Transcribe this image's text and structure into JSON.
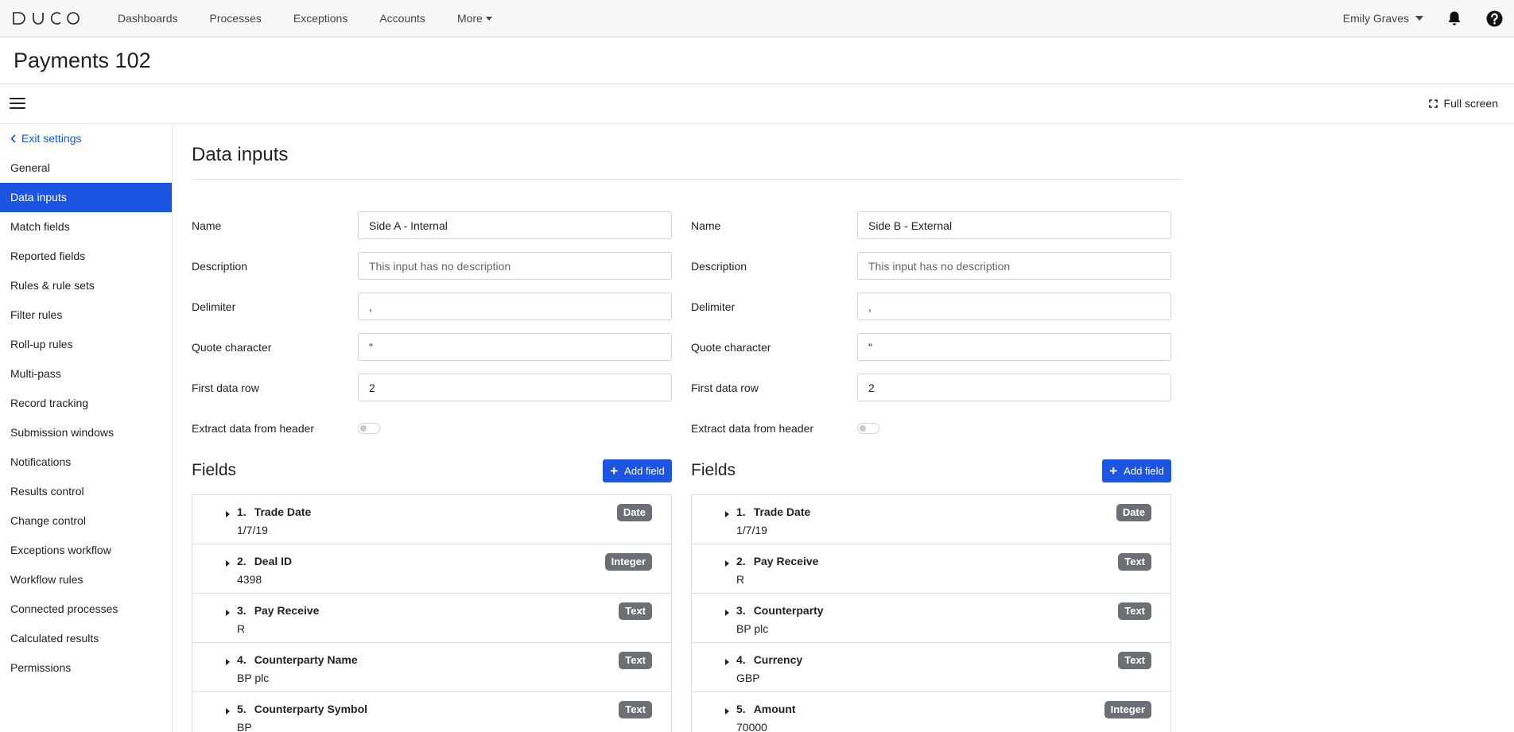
{
  "nav": {
    "logo_text": "DUCO",
    "links": [
      "Dashboards",
      "Processes",
      "Exceptions",
      "Accounts"
    ],
    "more": "More",
    "user": "Emily Graves"
  },
  "page": {
    "title": "Payments 102"
  },
  "toolbar": {
    "fullscreen": "Full screen"
  },
  "sidebar": {
    "exit": "Exit settings",
    "items": [
      "General",
      "Data inputs",
      "Match fields",
      "Reported fields",
      "Rules & rule sets",
      "Filter rules",
      "Roll-up rules",
      "Multi-pass",
      "Record tracking",
      "Submission windows",
      "Notifications",
      "Results control",
      "Change control",
      "Exceptions workflow",
      "Workflow rules",
      "Connected processes",
      "Calculated results",
      "Permissions"
    ],
    "active": "Data inputs"
  },
  "main": {
    "title": "Data inputs",
    "labels": {
      "name": "Name",
      "description": "Description",
      "delimiter": "Delimiter",
      "quote": "Quote character",
      "first_row": "First data row",
      "extract": "Extract data from header",
      "fields": "Fields",
      "add_field": "Add field"
    },
    "side_a": {
      "name": "Side A - Internal",
      "description_placeholder": "This input has no description",
      "delimiter": ",",
      "quote": "\"",
      "first_row": "2",
      "fields": [
        {
          "num": "1.",
          "name": "Trade Date",
          "value": "1/7/19",
          "type": "Date"
        },
        {
          "num": "2.",
          "name": "Deal ID",
          "value": "4398",
          "type": "Integer"
        },
        {
          "num": "3.",
          "name": "Pay Receive",
          "value": "R",
          "type": "Text"
        },
        {
          "num": "4.",
          "name": "Counterparty Name",
          "value": "BP plc",
          "type": "Text"
        },
        {
          "num": "5.",
          "name": "Counterparty Symbol",
          "value": "BP",
          "type": "Text"
        }
      ]
    },
    "side_b": {
      "name": "Side B - External",
      "description_placeholder": "This input has no description",
      "delimiter": ",",
      "quote": "\"",
      "first_row": "2",
      "fields": [
        {
          "num": "1.",
          "name": "Trade Date",
          "value": "1/7/19",
          "type": "Date"
        },
        {
          "num": "2.",
          "name": "Pay Receive",
          "value": "R",
          "type": "Text"
        },
        {
          "num": "3.",
          "name": "Counterparty",
          "value": "BP plc",
          "type": "Text"
        },
        {
          "num": "4.",
          "name": "Currency",
          "value": "GBP",
          "type": "Text"
        },
        {
          "num": "5.",
          "name": "Amount",
          "value": "70000",
          "type": "Integer"
        }
      ]
    }
  },
  "colors": {
    "accent": "#1b55e2",
    "badge": "#6b7077"
  }
}
